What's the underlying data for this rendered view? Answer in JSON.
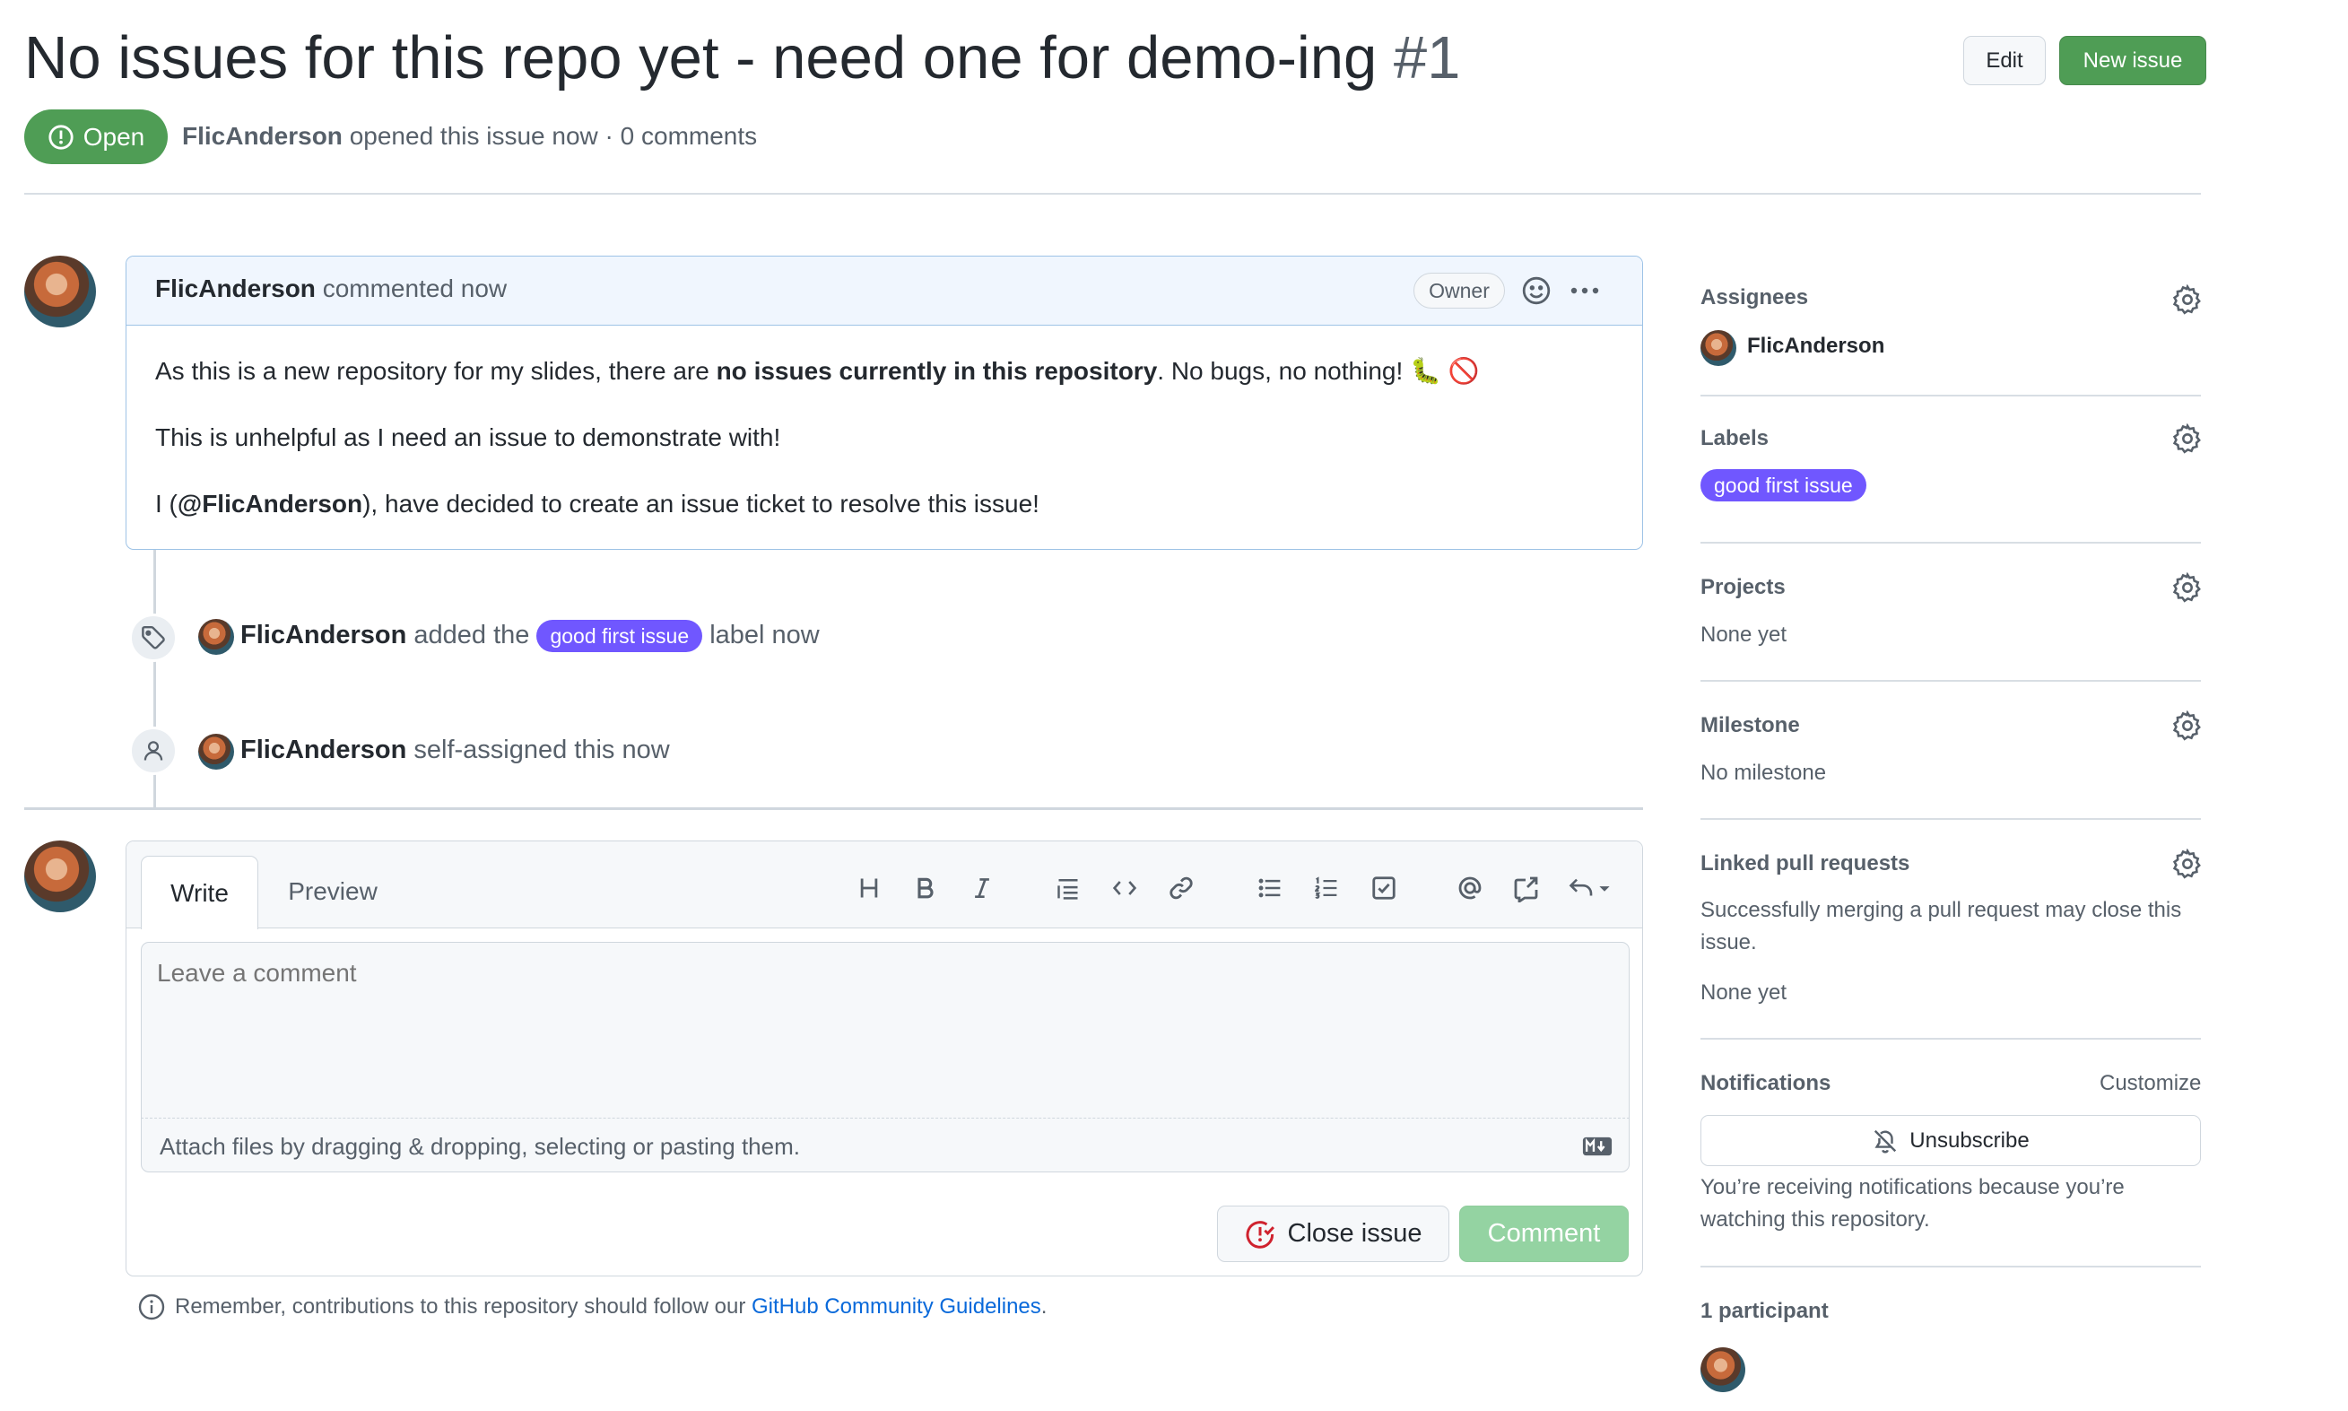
{
  "issue": {
    "title": "No issues for this repo yet - need one for demo-ing",
    "number": "#1",
    "state": "Open",
    "author": "FlicAnderson",
    "opened_text": "opened this issue now · 0 comments"
  },
  "header_actions": {
    "edit_label": "Edit",
    "new_issue_label": "New issue"
  },
  "comment": {
    "author": "FlicAnderson",
    "time_text": "commented now",
    "role_badge": "Owner",
    "p1_a": "As this is a new repository for my slides, there are ",
    "p1_bold": "no issues currently in this repository",
    "p1_b": ". No bugs, no nothing! 🐛 🚫",
    "p2": "This is unhelpful as I need an issue to demonstrate with!",
    "p3_a": "I (",
    "p3_mention": "@FlicAnderson",
    "p3_b": "), have decided to create an issue ticket to resolve this issue!"
  },
  "timeline": [
    {
      "icon": "tag-icon",
      "actor": "FlicAnderson",
      "pre": "added the",
      "label": "good first issue",
      "post": "label now"
    },
    {
      "icon": "person-icon",
      "actor": "FlicAnderson",
      "text": "self-assigned this now"
    }
  ],
  "editor": {
    "tab_write": "Write",
    "tab_preview": "Preview",
    "toolbar": [
      "heading-icon",
      "bold-icon",
      "italic-icon",
      "quote-icon",
      "code-icon",
      "link-icon",
      "bullet-list-icon",
      "numbered-list-icon",
      "task-list-icon",
      "mention-icon",
      "cross-reference-icon",
      "reply-icon"
    ],
    "placeholder": "Leave a comment",
    "attach_text": "Attach files by dragging & dropping, selecting or pasting them.",
    "close_label": "Close issue",
    "comment_label": "Comment"
  },
  "reminder": {
    "text": "Remember, contributions to this repository should follow our ",
    "link": "GitHub Community Guidelines",
    "end": "."
  },
  "sidebar": {
    "assignees": {
      "heading": "Assignees",
      "user": "FlicAnderson"
    },
    "labels": {
      "heading": "Labels",
      "label": "good first issue",
      "color": "#7057ff"
    },
    "projects": {
      "heading": "Projects",
      "value": "None yet"
    },
    "milestone": {
      "heading": "Milestone",
      "value": "No milestone"
    },
    "linked_prs": {
      "heading": "Linked pull requests",
      "desc1": "Successfully merging a pull request may close this",
      "desc2": "issue.",
      "value": "None yet"
    },
    "notifications": {
      "heading": "Notifications",
      "customize": "Customize",
      "button": "Unsubscribe",
      "desc1": "You’re receiving notifications because you’re",
      "desc2": "watching this repository."
    },
    "participants": {
      "heading": "1 participant"
    }
  },
  "colors": {
    "green": "#4f9d55",
    "label_purple": "#7057ff",
    "link": "#0969da"
  }
}
